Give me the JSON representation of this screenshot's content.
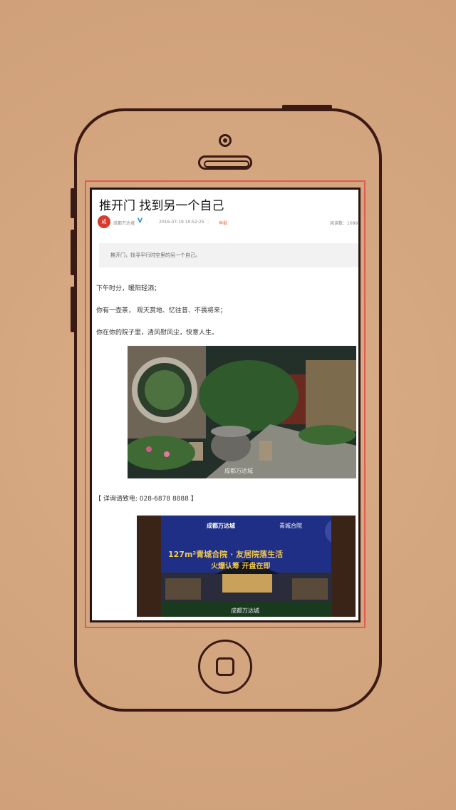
{
  "article": {
    "title": "推开门 找到另一个自己",
    "author": "成都万达城",
    "author_avatar_text": "成",
    "verified_mark": "V",
    "date": "2016-07-19 10:52:25",
    "report_label": "举报",
    "read_count": "阅读数：1099",
    "summary": "推开门，找寻平行时空里的另一个自己。",
    "paragraphs": [
      "下午时分，暖阳轻洒；",
      "你有一壶茶， 观天赏地、忆往昔、不畏将来；",
      "你在你的院子里，清风慰风尘，快意人生。"
    ],
    "image1_caption": "成都万达城",
    "contact": "【 详询请致电: 028-6878 8888 】",
    "banner": {
      "brand": "成都万达城",
      "project": "青城合院",
      "headline": "127m²青城合院 · 友居院落生活",
      "subline": "火爆认筹  开盘在即",
      "caption": "成都万达城"
    }
  },
  "colors": {
    "background": "#d4a680",
    "phone_outline": "#3b1a14",
    "screen_highlight": "#e25a50",
    "banner_blue": "#22338e",
    "banner_gold": "#f2c94c"
  }
}
